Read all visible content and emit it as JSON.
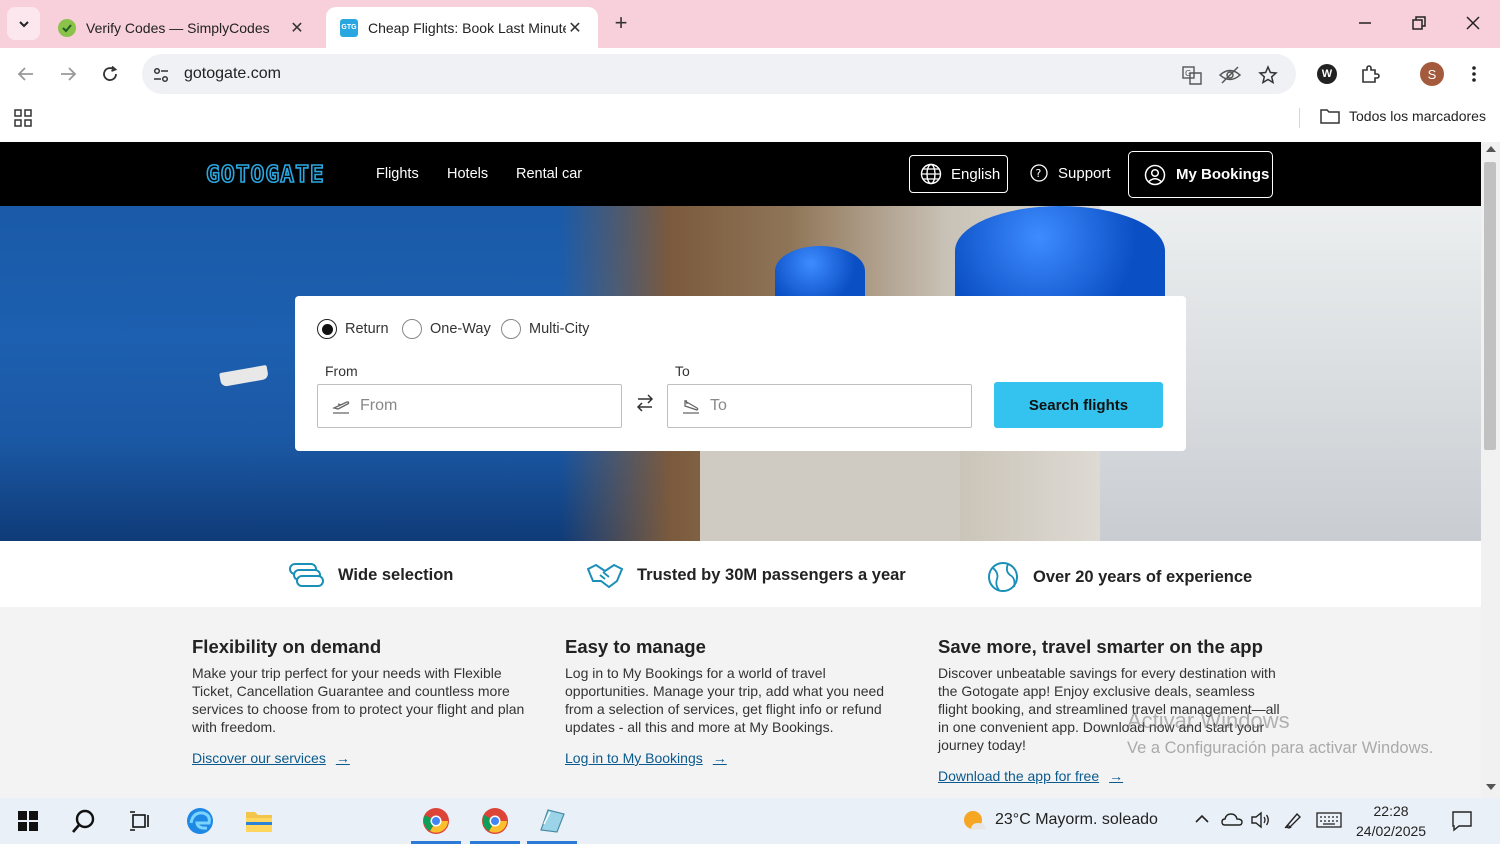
{
  "browser": {
    "tabs": [
      {
        "title": "Verify Codes — SimplyCodes",
        "active": false
      },
      {
        "title": "Cheap Flights: Book Last Minute",
        "active": true
      }
    ],
    "url": "gotogate.com",
    "bookmarks_all": "Todos los marcadores",
    "profile_initial": "S"
  },
  "site": {
    "logo": "GOTOGATE",
    "nav": [
      "Flights",
      "Hotels",
      "Rental car"
    ],
    "language": "English",
    "support": "Support",
    "my_bookings": "My Bookings"
  },
  "search": {
    "trip_types": [
      "Return",
      "One-Way",
      "Multi-City"
    ],
    "selected_trip_type": "Return",
    "from_label": "From",
    "from_placeholder": "From",
    "to_label": "To",
    "to_placeholder": "To",
    "button": "Search flights"
  },
  "usps": [
    "Wide selection",
    "Trusted by 30M passengers a year",
    "Over 20 years of experience"
  ],
  "info": [
    {
      "title": "Flexibility on demand",
      "text": "Make your trip perfect for your needs with Flexible Ticket, Cancellation Guarantee and countless more services to choose from to protect your flight and plan with freedom.",
      "link": "Discover our services"
    },
    {
      "title": "Easy to manage",
      "text": "Log in to My Bookings for a world of travel opportunities. Manage your trip, add what you need from a selection of services, get flight info or refund updates - all this and more at My Bookings.",
      "link": "Log in to My Bookings"
    },
    {
      "title": "Save more, travel smarter on the app",
      "text": "Discover unbeatable savings for every destination with the Gotogate app! Enjoy exclusive deals, seamless flight booking, and streamlined travel management—all in one convenient app. Download now and start your journey today!",
      "link": "Download the app for free"
    }
  ],
  "watermark": {
    "line1": "Activar Windows",
    "line2": "Ve a Configuración para activar Windows."
  },
  "taskbar": {
    "weather": "23°C  Mayorm. soleado",
    "time": "22:28",
    "date": "24/02/2025"
  },
  "colors": {
    "accent": "#33c3ee",
    "logo": "#2aa7e0",
    "tabstrip": "#f7d0dc",
    "link": "#0a5a8e"
  }
}
